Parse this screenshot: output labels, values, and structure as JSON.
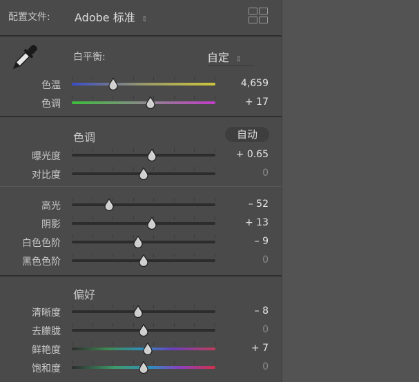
{
  "profile": {
    "label": "配置文件:",
    "value": "Adobe 标准",
    "arrows": "⇕"
  },
  "white_balance": {
    "label": "白平衡:",
    "value": "自定",
    "arrows": "⇕"
  },
  "sliders_wb": [
    {
      "label": "色温",
      "value": "4,659",
      "position": 0.29
    },
    {
      "label": "色调",
      "value": "+ 17",
      "position": 0.55
    }
  ],
  "tone": {
    "title": "色调",
    "auto_label": "自动"
  },
  "sliders_tone1": [
    {
      "label": "曝光度",
      "value": "+ 0.65",
      "position": 0.56
    },
    {
      "label": "对比度",
      "value": "0",
      "position": 0.5
    }
  ],
  "sliders_tone2": [
    {
      "label": "高光",
      "value": "– 52",
      "position": 0.26
    },
    {
      "label": "阴影",
      "value": "+ 13",
      "position": 0.56
    },
    {
      "label": "白色色阶",
      "value": "– 9",
      "position": 0.46
    },
    {
      "label": "黑色色阶",
      "value": "0",
      "position": 0.5
    }
  ],
  "presence": {
    "title": "偏好"
  },
  "sliders_presence": [
    {
      "label": "清晰度",
      "value": "– 8",
      "position": 0.46
    },
    {
      "label": "去朦胧",
      "value": "0",
      "position": 0.5
    },
    {
      "label": "鲜艳度",
      "value": "+ 7",
      "position": 0.53
    },
    {
      "label": "饱和度",
      "value": "0",
      "position": 0.5
    }
  ],
  "icons": {
    "eyedropper": "eyedropper-icon",
    "grid": "profile-browser-grid-icon"
  },
  "colors": {
    "panel": "#4a4a4a",
    "background": "#535353",
    "text": "#c8c8c8"
  }
}
